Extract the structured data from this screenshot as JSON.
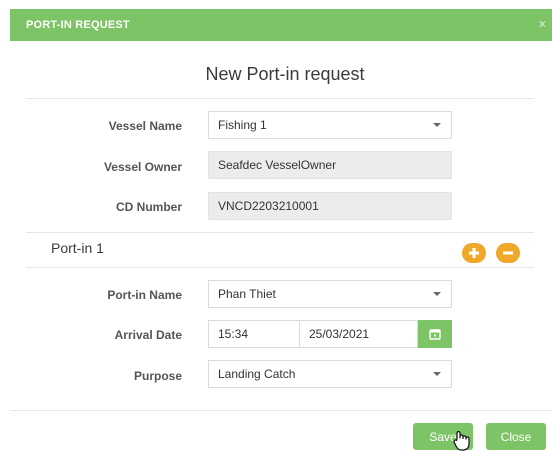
{
  "dialog": {
    "header_title": "PORT-IN REQUEST",
    "close_glyph": "×",
    "title": "New Port-in request"
  },
  "vessel": {
    "name_label": "Vessel Name",
    "name_value": "Fishing 1",
    "owner_label": "Vessel Owner",
    "owner_value": "Seafdec VesselOwner",
    "cd_label": "CD Number",
    "cd_value": "VNCD2203210001"
  },
  "port_in": {
    "section_title": "Port-in 1",
    "name_label": "Port-in Name",
    "name_value": "Phan Thiet",
    "arrival_label": "Arrival Date",
    "arrival_time": "15:34",
    "arrival_date": "25/03/2021",
    "purpose_label": "Purpose",
    "purpose_value": "Landing Catch"
  },
  "footer": {
    "save_label": "Save",
    "close_label": "Close"
  },
  "colors": {
    "accent_green": "#7dc466",
    "accent_orange": "#f0a82b"
  }
}
